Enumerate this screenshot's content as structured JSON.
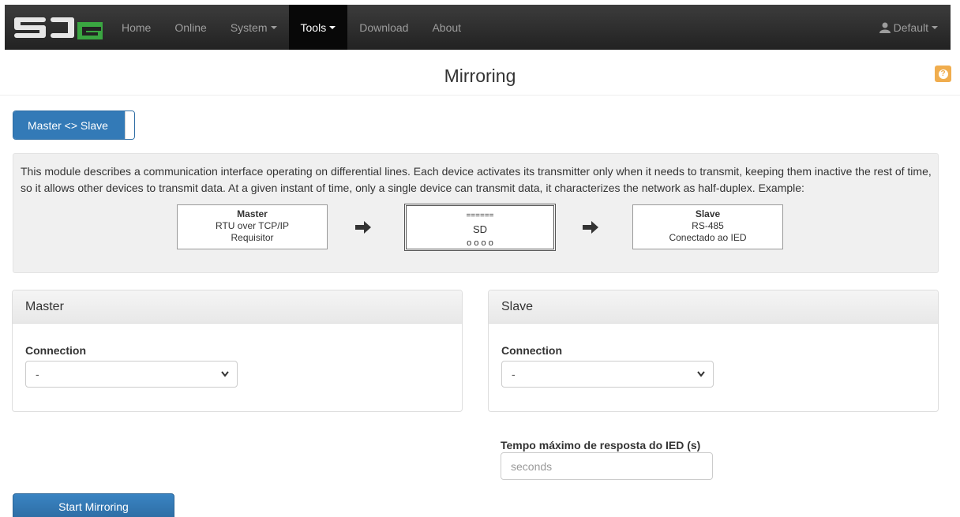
{
  "navbar": {
    "brand": "SDG",
    "items": [
      {
        "label": "Home",
        "active": false,
        "dropdown": false
      },
      {
        "label": "Online",
        "active": false,
        "dropdown": false
      },
      {
        "label": "System",
        "active": false,
        "dropdown": true
      },
      {
        "label": "Tools",
        "active": true,
        "dropdown": true
      },
      {
        "label": "Download",
        "active": false,
        "dropdown": false
      },
      {
        "label": "About",
        "active": false,
        "dropdown": false
      }
    ],
    "user": "Default"
  },
  "page": {
    "title": "Mirroring",
    "help_icon": "question-circle-icon"
  },
  "mode_toggle": {
    "label": "Master <> Slave",
    "state": "on"
  },
  "info": {
    "text": "This module describes a communication interface operating on differential lines. Each device activates its transmitter only when it needs to transmit, keeping them inactive the rest of time, so it allows other devices to transmit data. At a given instant of time, only a single device can transmit data, it characterizes the network as half-duplex. Example:",
    "diagram": {
      "master": {
        "title": "Master",
        "line1": "RTU over TCP/IP",
        "line2": "Requisitor"
      },
      "sd": {
        "top": "======",
        "middle": "SD",
        "bottom": "o o o o"
      },
      "slave": {
        "title": "Slave",
        "line1": "RS-485",
        "line2": "Conectado ao IED"
      }
    }
  },
  "master_panel": {
    "heading": "Master",
    "connection_label": "Connection",
    "connection_value": "-"
  },
  "slave_panel": {
    "heading": "Slave",
    "connection_label": "Connection",
    "connection_value": "-"
  },
  "tempo": {
    "label": "Tempo máximo de resposta do IED (s)",
    "placeholder": "seconds"
  },
  "start_button": "Start Mirroring",
  "colors": {
    "navbar_bg": "#222222",
    "primary": "#337ab7",
    "warning": "#f0ad4e"
  }
}
